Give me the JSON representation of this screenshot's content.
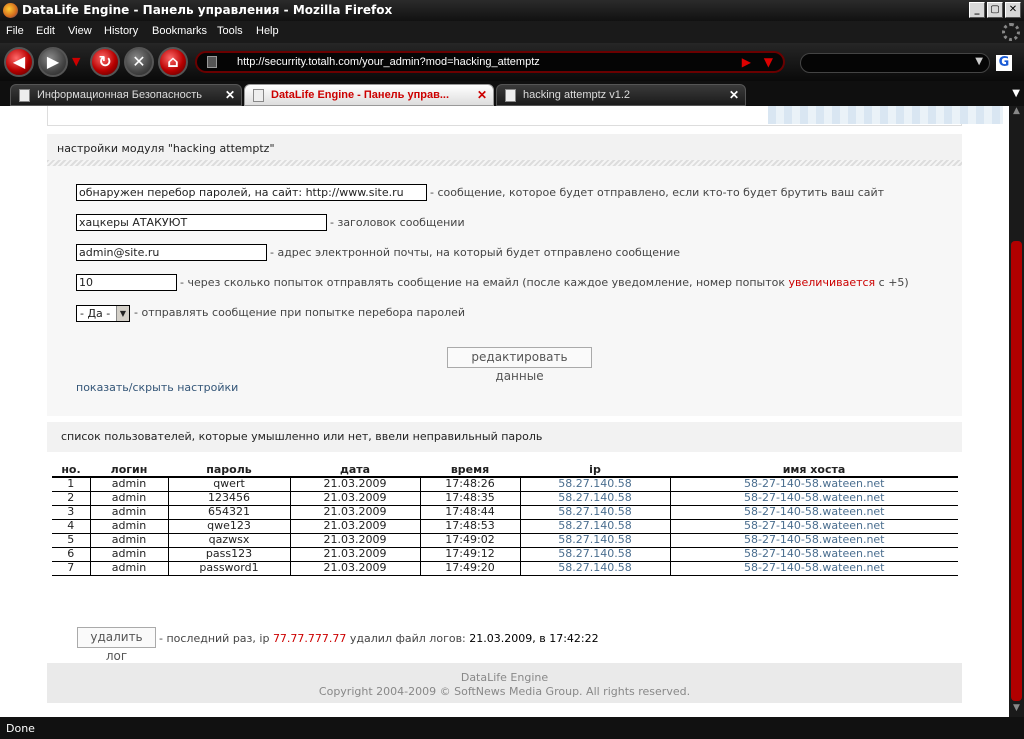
{
  "window": {
    "title": "DataLife Engine - Панель управления - Mozilla Firefox"
  },
  "menu": [
    "File",
    "Edit",
    "View",
    "History",
    "Bookmarks",
    "Tools",
    "Help"
  ],
  "nav": {
    "url": "http://securrity.totalh.com/your_admin?mod=hacking_attemptz",
    "search_placeholder": ""
  },
  "tabs": [
    {
      "label": "Информационная Безопасность",
      "active": false
    },
    {
      "label": "DataLife Engine - Панель управ...",
      "active": true
    },
    {
      "label": "hacking attemptz v1.2",
      "active": false
    }
  ],
  "settings": {
    "title": "настройки модуля \"hacking attemptz\"",
    "message_value": "обнаружен перебор паролей, на сайт: http://www.site.ru",
    "message_desc": "- сообщение, которое будет отправлено, если кто-то будет брутить ваш сайт",
    "subject_value": "хацкеры АТАКУЮТ",
    "subject_desc": "- заголовок сообщении",
    "email_value": "admin@site.ru",
    "email_desc": "- адрес электронной почты, на который будет отправлено сообщение",
    "attempts_value": "10",
    "attempts_desc_1": "- через сколько попыток отправлять сообщение на емайл (после каждое уведомление, номер попыток ",
    "attempts_desc_hl": "увеличивается",
    "attempts_desc_2": " с +5)",
    "send_value": "- Да -",
    "send_desc": "- отправлять сообщение при попытке перебора паролей",
    "submit_label": "редактировать данные",
    "toggle_link": "показать/скрыть настройки"
  },
  "log": {
    "title": "список пользователей, которые умышленно или нет, ввели неправильный пароль",
    "columns": [
      "но.",
      "логин",
      "пароль",
      "дата",
      "время",
      "ip",
      "имя хоста"
    ],
    "rows": [
      [
        "1",
        "admin",
        "qwert",
        "21.03.2009",
        "17:48:26",
        "58.27.140.58",
        "58-27-140-58.wateen.net"
      ],
      [
        "2",
        "admin",
        "123456",
        "21.03.2009",
        "17:48:35",
        "58.27.140.58",
        "58-27-140-58.wateen.net"
      ],
      [
        "3",
        "admin",
        "654321",
        "21.03.2009",
        "17:48:44",
        "58.27.140.58",
        "58-27-140-58.wateen.net"
      ],
      [
        "4",
        "admin",
        "qwe123",
        "21.03.2009",
        "17:48:53",
        "58.27.140.58",
        "58-27-140-58.wateen.net"
      ],
      [
        "5",
        "admin",
        "qazwsx",
        "21.03.2009",
        "17:49:02",
        "58.27.140.58",
        "58-27-140-58.wateen.net"
      ],
      [
        "6",
        "admin",
        "pass123",
        "21.03.2009",
        "17:49:12",
        "58.27.140.58",
        "58-27-140-58.wateen.net"
      ],
      [
        "7",
        "admin",
        "password1",
        "21.03.2009",
        "17:49:20",
        "58.27.140.58",
        "58-27-140-58.wateen.net"
      ]
    ],
    "delete_label": "удалить лог",
    "last_text_1": "- последний раз, ip ",
    "last_ip": "77.77.777.77",
    "last_text_2": " удалил файл логов: ",
    "last_date": "21.03.2009, в 17:42:22"
  },
  "footer": {
    "line1": "DataLife Engine",
    "line2": "Copyright 2004-2009 © SoftNews Media Group. All rights reserved."
  },
  "status": {
    "text": "Done"
  },
  "colors": {
    "accent": "#b00000",
    "highlight": "#cc0000",
    "ip_link": "#4a6e8f"
  }
}
